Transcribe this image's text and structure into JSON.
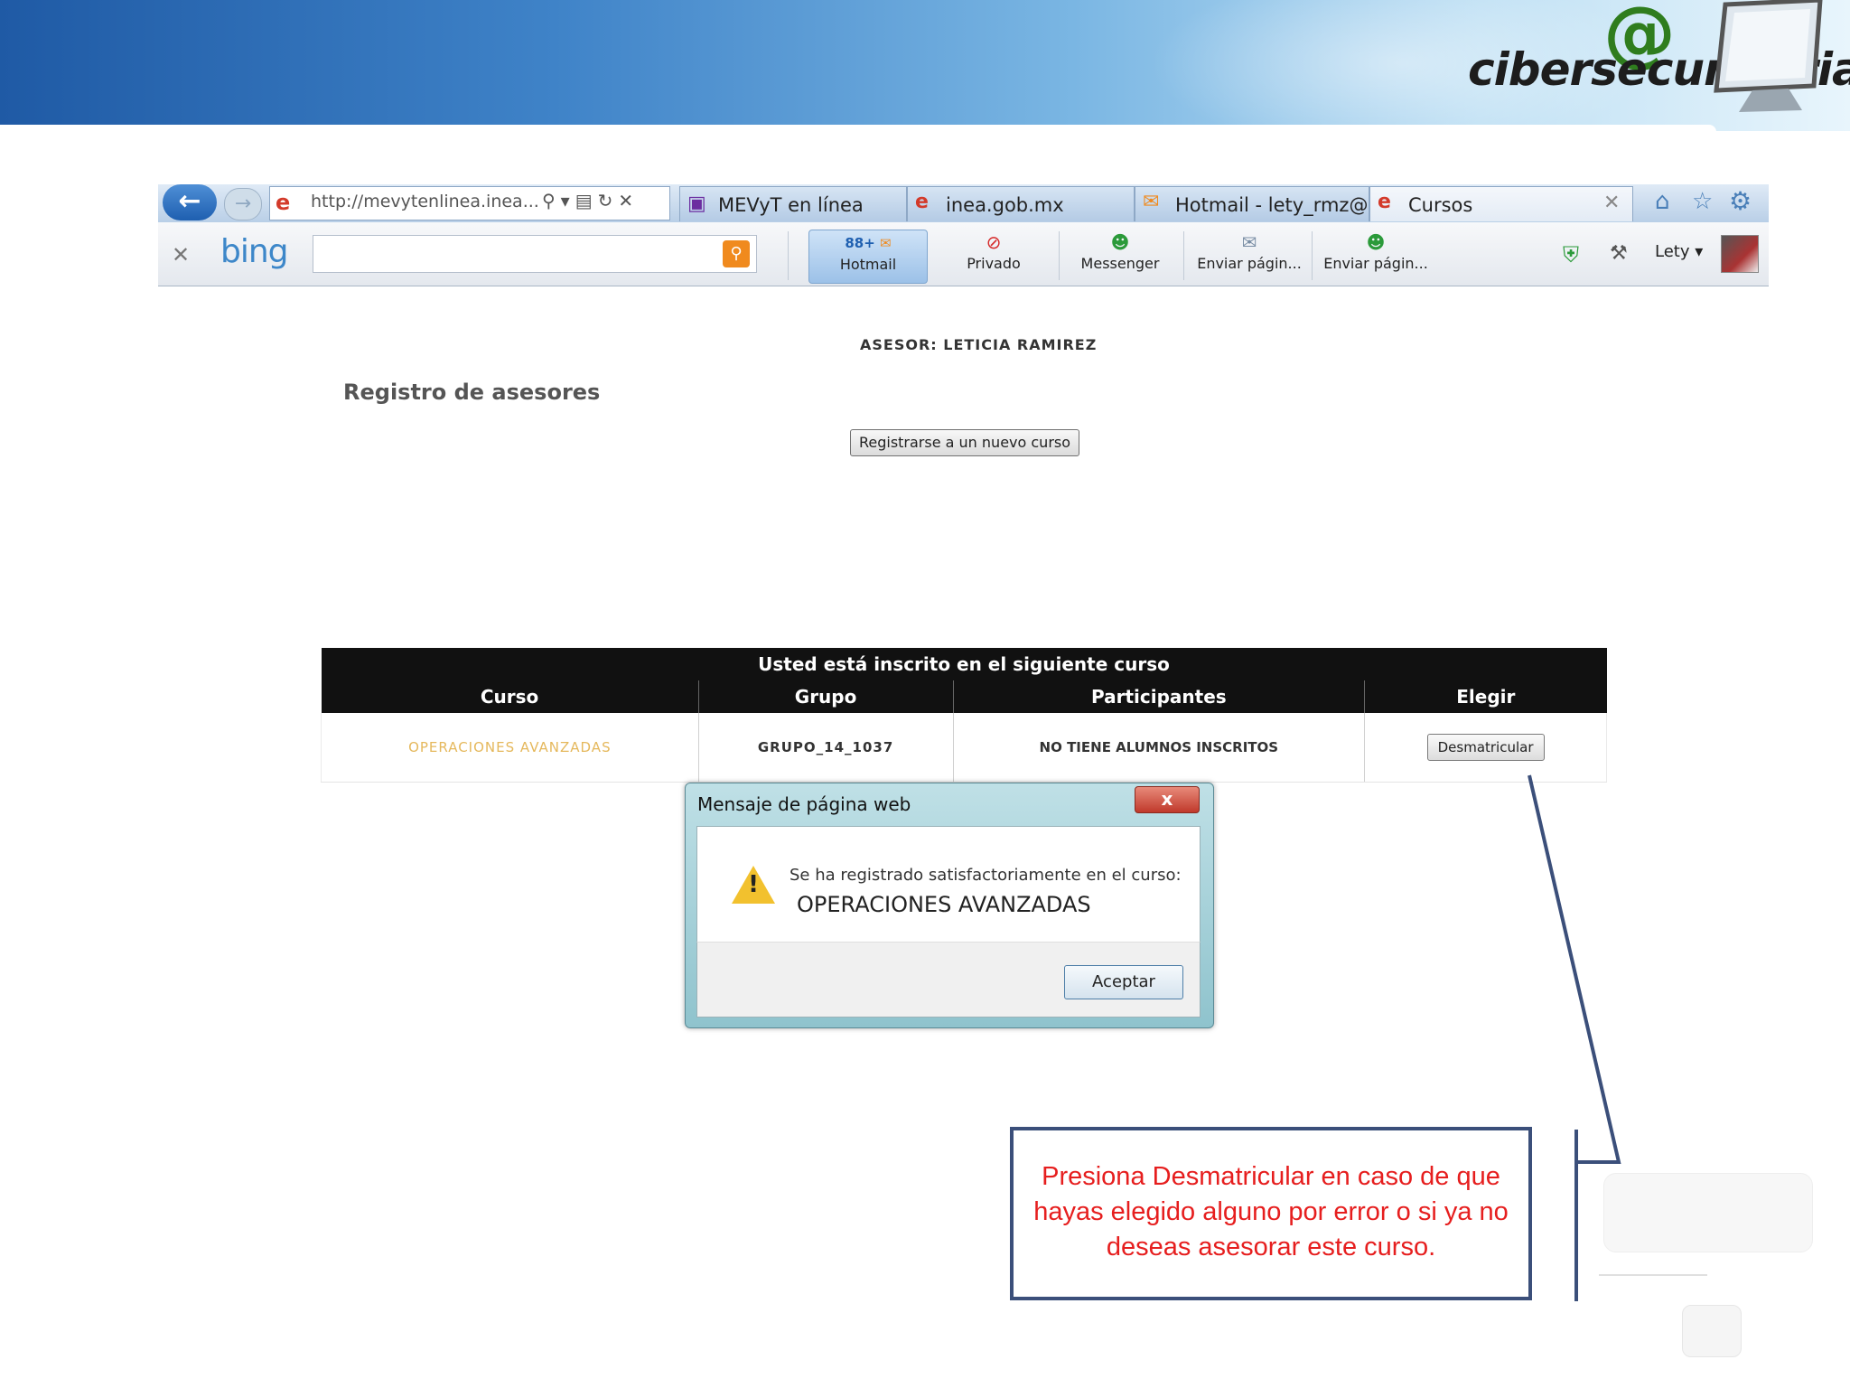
{
  "banner": {
    "logo_text": "cibersecundaria",
    "logo_symbol": "@"
  },
  "browser": {
    "address": "http://mevytenlinea.inea...",
    "tabs": [
      {
        "label": "MEVyT en línea",
        "icon": "mevyt-icon"
      },
      {
        "label": "inea.gob.mx",
        "icon": "ie-icon"
      },
      {
        "label": "Hotmail - lety_rmz@...",
        "icon": "hotmail-icon"
      },
      {
        "label": "Cursos",
        "icon": "ie-icon"
      }
    ],
    "toolbar": {
      "search_brand": "bing",
      "hotmail_badge": "88+",
      "hotmail": "Hotmail",
      "privado": "Privado",
      "messenger": "Messenger",
      "enviar1": "Enviar págin...",
      "enviar2": "Enviar págin...",
      "user": "Lety"
    }
  },
  "page": {
    "asesor": "ASESOR: LETICIA RAMIREZ",
    "title": "Registro de asesores",
    "register_button": "Registrarse a un nuevo curso",
    "table": {
      "caption": "Usted está inscrito en el siguiente curso",
      "headers": [
        "Curso",
        "Grupo",
        "Participantes",
        "Elegir"
      ],
      "rows": [
        {
          "curso": "OPERACIONES AVANZADAS",
          "grupo": "GRUPO_14_1037",
          "participantes": "NO TIENE ALUMNOS INSCRITOS",
          "action": "Desmatricular"
        }
      ]
    }
  },
  "dialog": {
    "title": "Mensaje de página web",
    "close": "x",
    "message": "Se ha registrado satisfactoriamente en el curso:",
    "course": "OPERACIONES AVANZADAS",
    "ok": "Aceptar"
  },
  "callout": {
    "text": "Presiona Desmatricular en caso de que hayas elegido alguno por error o si ya no deseas asesorar este curso."
  },
  "colors": {
    "callout_text": "#e61e1e",
    "callout_border": "#3b4f7a",
    "table_header": "#111111",
    "course_name": "#e5b85c"
  }
}
